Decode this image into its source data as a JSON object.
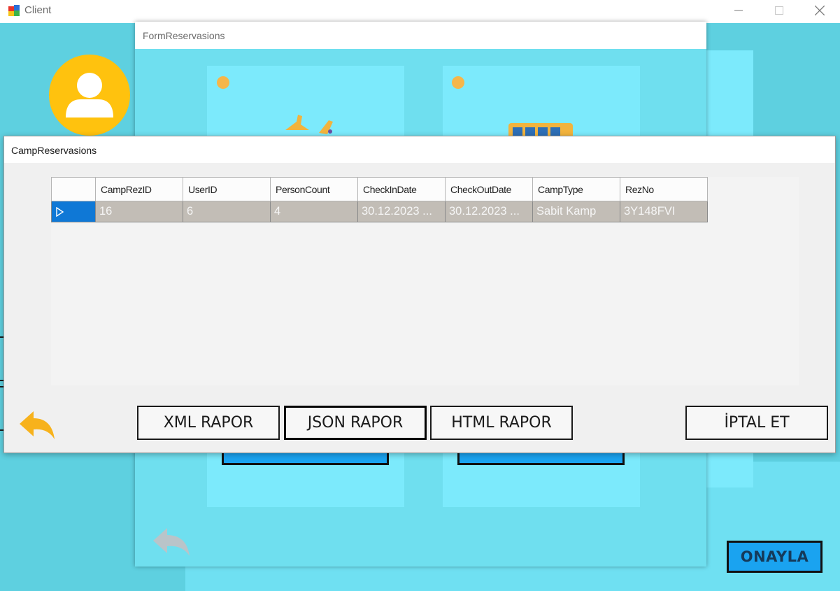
{
  "main_window": {
    "title": "Client",
    "confirm_label": "ONAYLA",
    "colors": {
      "background": "#5ed0e0",
      "avatar": "#ffc20e",
      "confirm_button": "#1aa3f0"
    }
  },
  "form_reservations": {
    "title": "FormReservasions",
    "colors": {
      "background": "#6fdfef",
      "panel": "#7ceafc"
    }
  },
  "camp_reservations": {
    "title": "CampReservasions",
    "grid": {
      "columns": [
        "CampRezID",
        "UserID",
        "PersonCount",
        "CheckInDate",
        "CheckOutDate",
        "CampType",
        "RezNo"
      ],
      "rows": [
        {
          "selected": true,
          "cells": [
            "16",
            "6",
            "4",
            "30.12.2023 ...",
            "30.12.2023 ...",
            "Sabit Kamp",
            "3Y148FVI"
          ]
        }
      ]
    },
    "buttons": {
      "xml_report": "XML RAPOR",
      "json_report": "JSON RAPOR",
      "html_report": "HTML RAPOR",
      "cancel": "İPTAL ET"
    },
    "icons": {
      "back": "back-arrow-icon",
      "row_indicator": "row-pointer-icon"
    }
  }
}
